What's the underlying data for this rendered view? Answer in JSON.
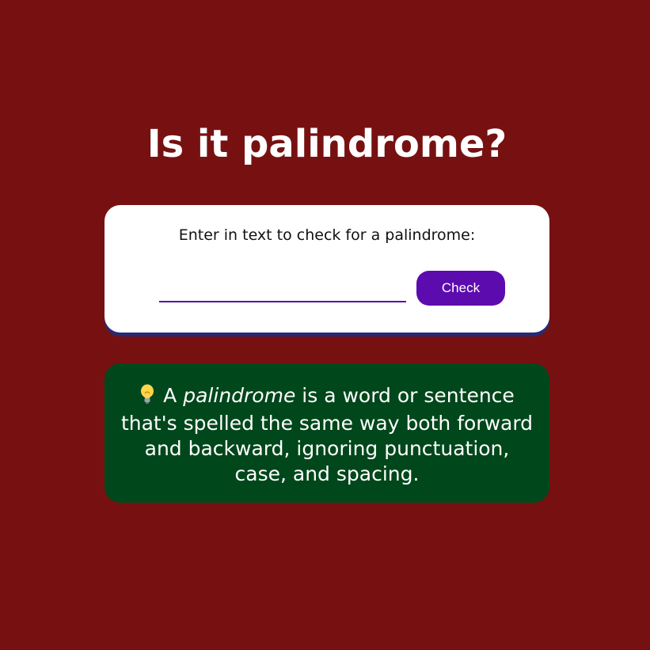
{
  "header": {
    "title": "Is it palindrome?"
  },
  "checker": {
    "label": "Enter in text to check for a palindrome:",
    "input_value": "",
    "button_label": "Check"
  },
  "info": {
    "icon": "lightbulb-icon",
    "article": "A",
    "term": "palindrome",
    "definition": "is a word or sentence that's spelled the same way both forward and backward, ignoring punctuation, case, and spacing."
  },
  "colors": {
    "background": "#771111",
    "card": "#ffffff",
    "card_shadow": "#282a73",
    "accent": "#5c0bae",
    "info_background": "#00471b",
    "text_light": "#ffffff"
  }
}
